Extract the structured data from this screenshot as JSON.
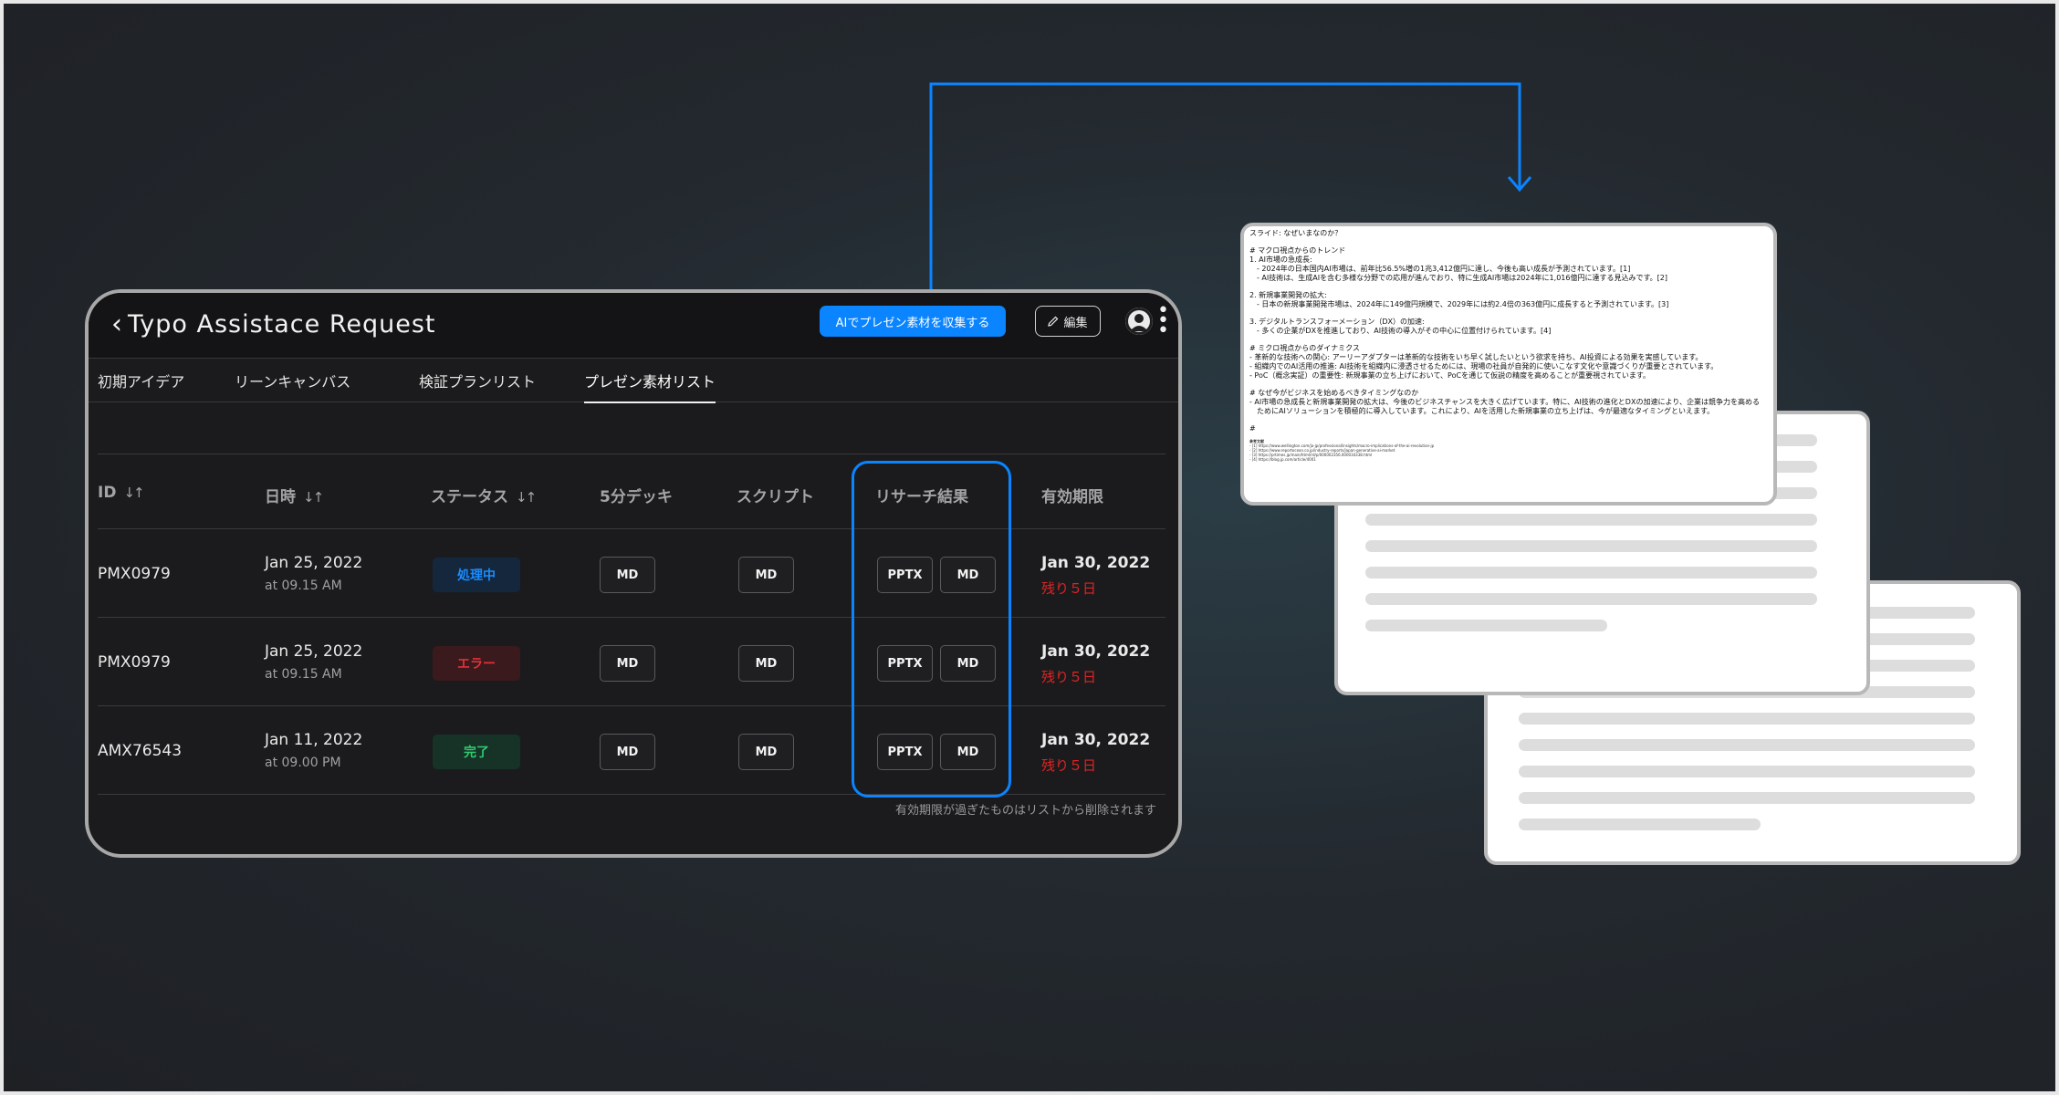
{
  "app": {
    "title": "Typo Assistace Request",
    "ai_button_label": "AIでプレゼン素材を収集する",
    "edit_button_label": "編集"
  },
  "tabs": [
    {
      "label": "初期アイデア",
      "active": false
    },
    {
      "label": "リーンキャンバス",
      "active": false
    },
    {
      "label": "検証プランリスト",
      "active": false
    },
    {
      "label": "プレゼン素材リスト",
      "active": true
    }
  ],
  "table": {
    "columns": [
      "ID",
      "日時",
      "ステータス",
      "5分デッキ",
      "スクリプト",
      "リサーチ結果",
      "有効期限"
    ],
    "rows": [
      {
        "id": "PMX0979",
        "date": "Jan 25, 2022",
        "time": "at 09.15 AM",
        "status": "処理中",
        "deck": "MD",
        "script": "MD",
        "research_pptx": "PPTX",
        "research_md": "MD",
        "expiry": "Jan 30, 2022",
        "remaining": "残り５日"
      },
      {
        "id": "PMX0979",
        "date": "Jan 25, 2022",
        "time": "at 09.15 AM",
        "status": "エラー",
        "deck": "MD",
        "script": "MD",
        "research_pptx": "PPTX",
        "research_md": "MD",
        "expiry": "Jan 30, 2022",
        "remaining": "残り５日"
      },
      {
        "id": "AMX76543",
        "date": "Jan 11, 2022",
        "time": "at 09.00 PM",
        "status": "完了",
        "deck": "MD",
        "script": "MD",
        "research_pptx": "PPTX",
        "research_md": "MD",
        "expiry": "Jan 30, 2022",
        "remaining": "残り５日"
      }
    ],
    "footnote": "有効期限が過ぎたものはリストから削除されます"
  },
  "status_colors": {
    "processing": {
      "text": "#1a8cff",
      "bg": "#14273d"
    },
    "error": {
      "text": "#e0303a",
      "bg": "#3a1a1c"
    },
    "done": {
      "text": "#2ecc71",
      "bg": "#173226"
    }
  },
  "accent_color": "#0a84ff",
  "document": {
    "lines": [
      "スライド: なぜいまなのか？",
      "",
      "# マクロ視点からのトレンド",
      "1. AI市場の急成長:",
      "　- 2024年の日本国内AI市場は、前年比56.5%増の1兆3,412億円に達し、今後も高い成長が予測されています。[1]",
      "　- AI技術は、生成AIを含む多様な分野での応用が進んでおり、特に生成AI市場は2024年に1,016億円に達する見込みです。[2]",
      "",
      "2. 新規事業開発の拡大:",
      "　- 日本の新規事業開発市場は、2024年に149億円規模で、2029年には約2.4倍の363億円に成長すると予測されています。[3]",
      "",
      "3. デジタルトランスフォーメーション（DX）の加速:",
      "　- 多くの企業がDXを推進しており、AI技術の導入がその中心に位置付けられています。[4]",
      "",
      "# ミクロ視点からのダイナミクス",
      "- 革新的な技術への関心: アーリーアダプターは革新的な技術をいち早く試したいという欲求を持ち、AI投資による効果を実感しています。",
      "- 組織内でのAI活用の推進: AI技術を組織内に浸透させるためには、現場の社員が自発的に使いこなす文化や意識づくりが重要とされています。",
      "- PoC（概念実証）の重要性: 新規事業の立ち上げにおいて、PoCを通じて仮説の精度を高めることが重要視されています。",
      "",
      "# なぜ今がビジネスを始めるべきタイミングなのか",
      "- AI市場の急成長と新規事業開発の拡大は、今後のビジネスチャンスを大きく広げています。特に、AI技術の進化とDXの加速により、企業は競争力を高める",
      "　ためにAIソリューションを積極的に導入しています。これにより、AIを活用した新規事業の立ち上げは、今が最適なタイミングといえます。",
      "",
      "#"
    ],
    "references_title": "参考文献",
    "references": [
      "- [1] https://www.wellington.com/ja-jp/professional/insights/macro-implications-of-the-ai-revolution-jp",
      "- [2] https://www.reportocean.co.jp/industry-reports/japan-generative-ai-market",
      "- [3] https://prtimes.jp/main/html/rd/p/000002356.000034338.html",
      "- [4] https://blog.jp.com/article/4001"
    ]
  }
}
